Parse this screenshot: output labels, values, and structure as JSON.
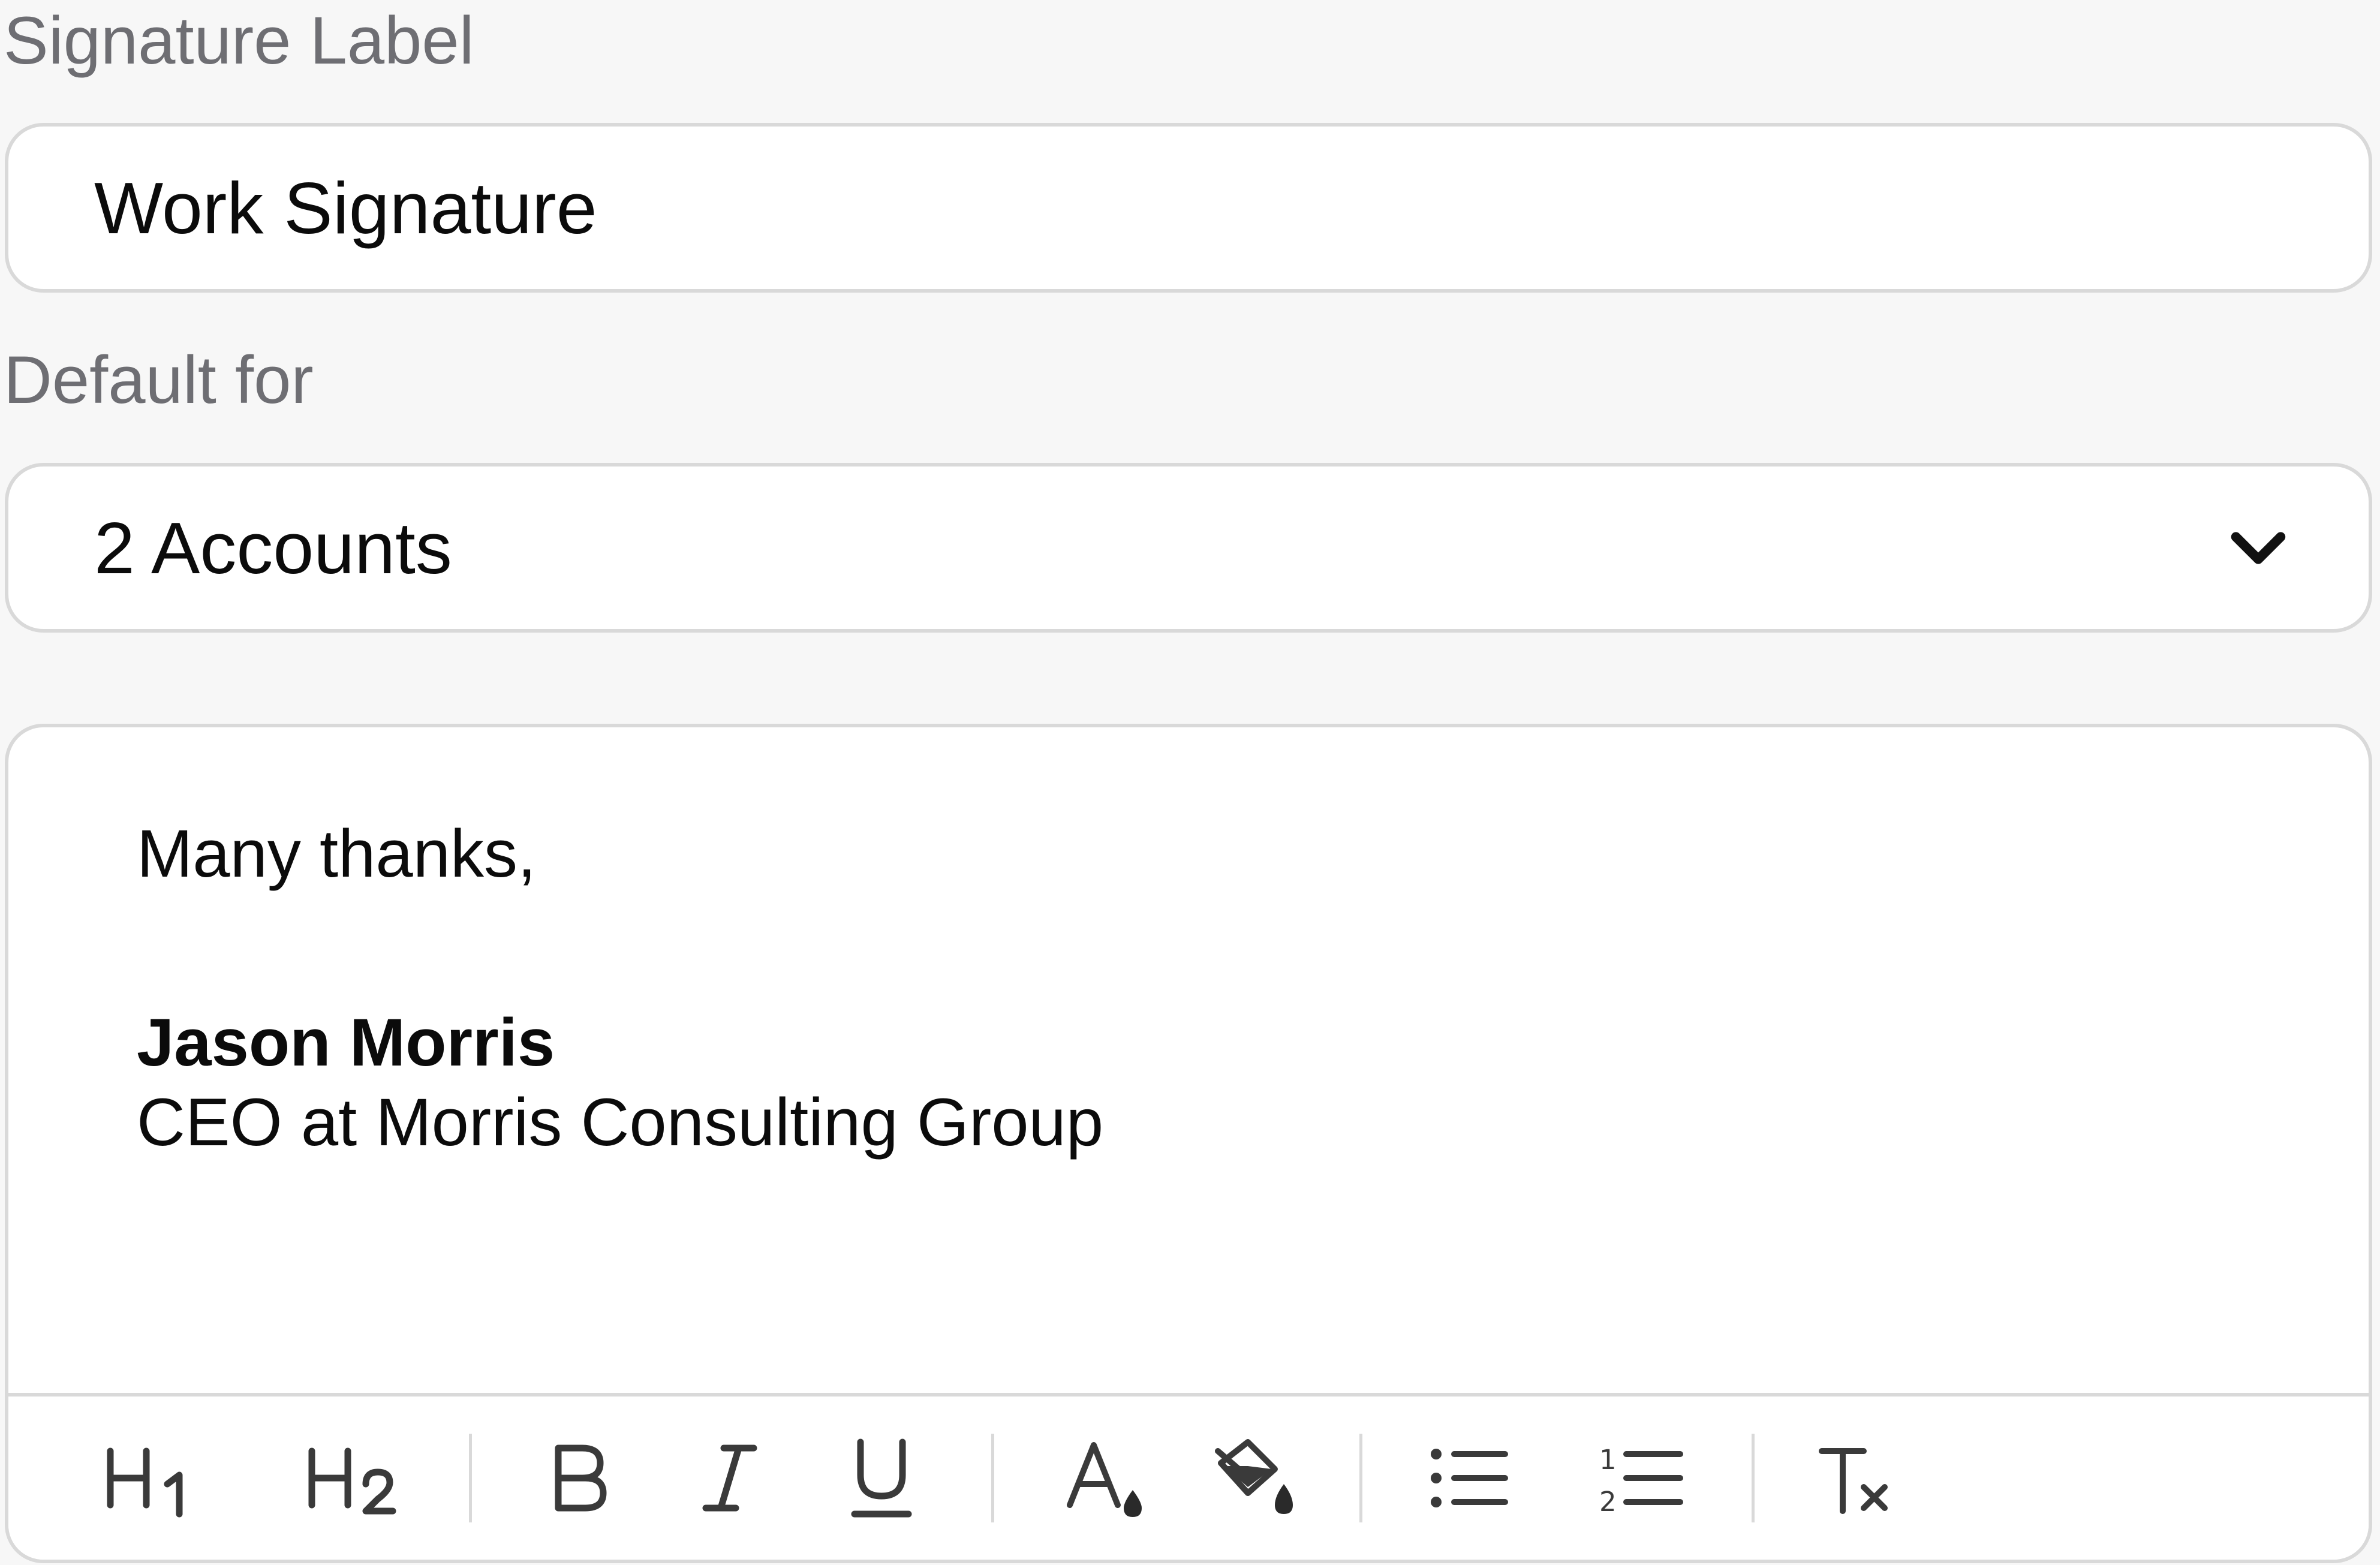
{
  "signature_label": {
    "label": "Signature Label",
    "value": "Work Signature"
  },
  "default_for": {
    "label": "Default for",
    "value": "2 Accounts",
    "icon": "chevron-down-icon"
  },
  "editor": {
    "lines": {
      "greeting": "Many thanks,",
      "name": "Jason Morris",
      "role": "CEO at Morris Consulting Group"
    },
    "toolbar": {
      "h1": {
        "icon": "heading-1-icon"
      },
      "h2": {
        "icon": "heading-2-icon"
      },
      "bold": {
        "label": "B",
        "icon": "bold-icon"
      },
      "italic": {
        "label": "I",
        "icon": "italic-icon"
      },
      "underline": {
        "label": "U",
        "icon": "underline-icon"
      },
      "text_color": {
        "icon": "text-color-icon"
      },
      "highlight": {
        "icon": "highlight-color-icon"
      },
      "bullet_list": {
        "icon": "bullet-list-icon"
      },
      "numbered_list": {
        "icon": "numbered-list-icon"
      },
      "clear_format": {
        "icon": "clear-formatting-icon"
      }
    }
  },
  "colors": {
    "background": "#f7f7f7",
    "field_background": "#ffffff",
    "border": "#d9d9d9",
    "label_text": "#6e6e73",
    "icon": "#3a3a3a"
  }
}
